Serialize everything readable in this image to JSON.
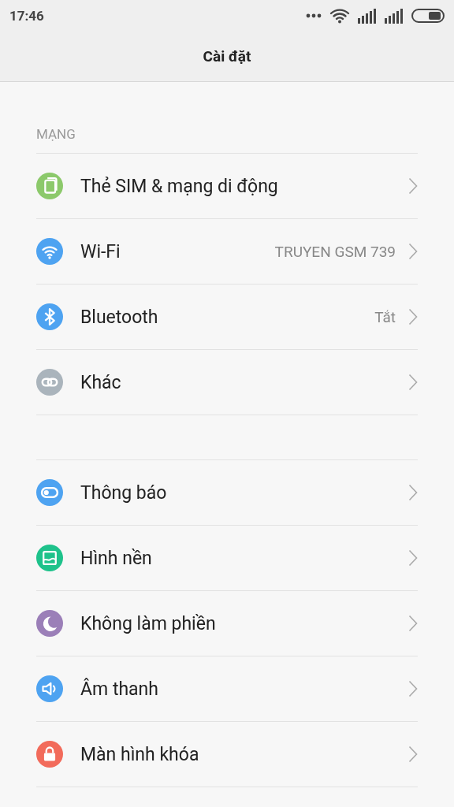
{
  "status_bar": {
    "time": "17:46"
  },
  "header": {
    "title": "Cài đặt"
  },
  "groups": [
    {
      "label": "MẠNG",
      "items": [
        {
          "label": "Thẻ SIM & mạng di động",
          "color": "#8cc96b"
        },
        {
          "label": "Wi-Fi",
          "value": "TRUYEN GSM 739",
          "color": "#4ea3f1"
        },
        {
          "label": "Bluetooth",
          "value": "Tắt",
          "color": "#4ea3f1"
        },
        {
          "label": "Khác",
          "color": "#aab4bc"
        }
      ]
    },
    {
      "items": [
        {
          "label": "Thông báo",
          "color": "#4ea3f1"
        },
        {
          "label": "Hình nền",
          "color": "#1ec28b"
        },
        {
          "label": "Không làm phiền",
          "color": "#9b7fb8"
        },
        {
          "label": "Âm thanh",
          "color": "#4ea3f1"
        },
        {
          "label": "Màn hình khóa",
          "color": "#f26b5b"
        }
      ]
    }
  ]
}
